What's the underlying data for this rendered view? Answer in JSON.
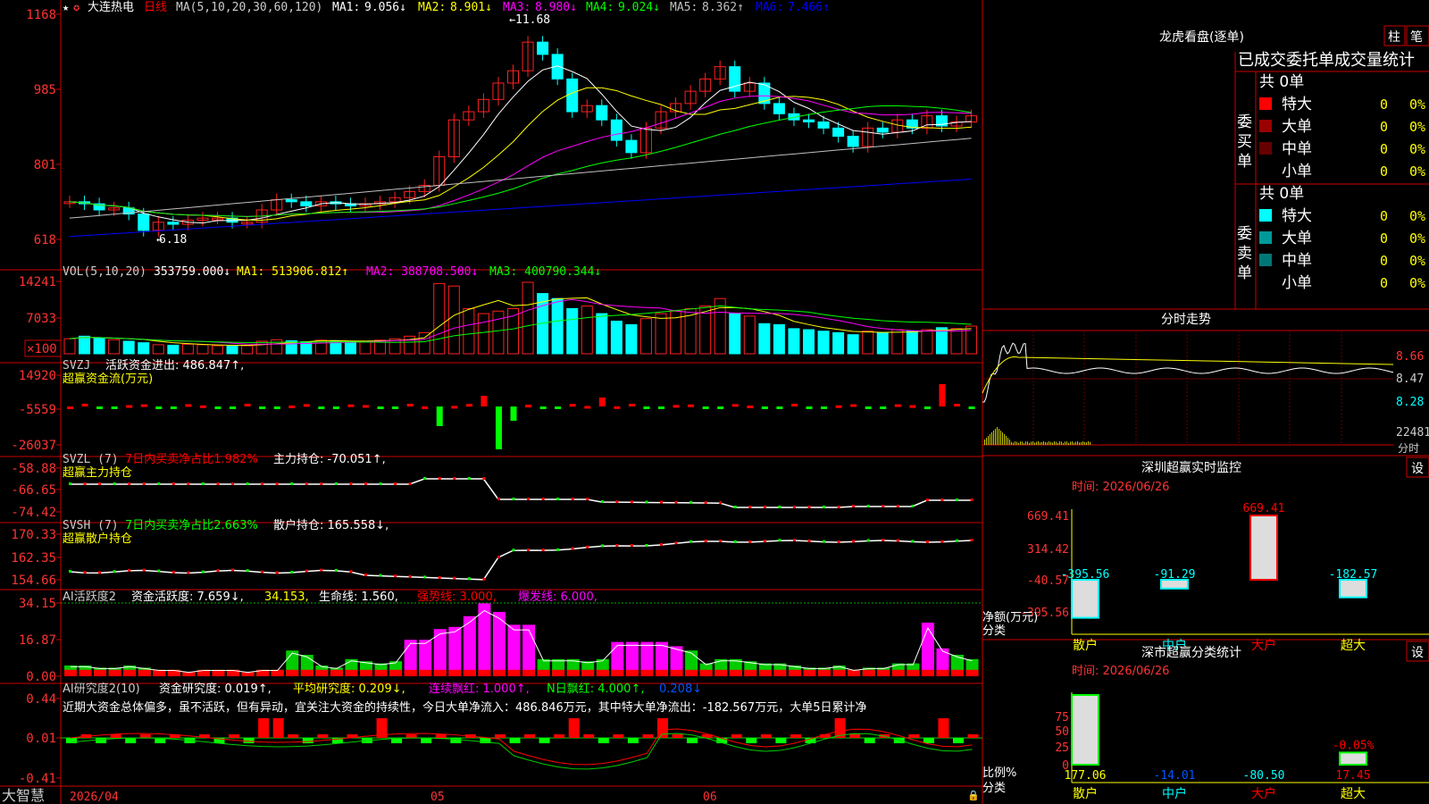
{
  "stock": {
    "name": "大连热电",
    "period": "日线",
    "ma_label": "MA(5,10,20,30,60,120)",
    "ma": [
      {
        "label": "MA1:",
        "value": "9.056↓",
        "color": "#ffffff"
      },
      {
        "label": "MA2:",
        "value": "8.901↓",
        "color": "#ffff00"
      },
      {
        "label": "MA3:",
        "value": "8.980↓",
        "color": "#ff00ff"
      },
      {
        "label": "MA4:",
        "value": "9.024↓",
        "color": "#00ff00"
      },
      {
        "label": "MA5:",
        "value": "8.362↑",
        "color": "#c0c0c0"
      },
      {
        "label": "MA6:",
        "value": "7.466↑",
        "color": "#0000ff"
      }
    ],
    "y_ticks": [
      "1168",
      "985",
      "801",
      "618"
    ],
    "high_label": "11.68",
    "low_label": "6.18"
  },
  "vol": {
    "title": "VOL(5,10,20)",
    "value": "353759.000↓",
    "ma1": "MA1: 513906.812↑",
    "ma2": "MA2: 388708.500↓",
    "ma3": "MA3: 400790.344↓",
    "y_ticks": [
      "14241",
      "7033",
      "×100"
    ]
  },
  "svzj": {
    "title": "SVZJ",
    "desc": "活跃资金进出: 486.847↑,",
    "sub": "超赢资金流(万元)",
    "y_ticks": [
      "14920",
      "-5559",
      "-26037"
    ]
  },
  "svzl": {
    "title": "SVZL (7)",
    "desc1": "7日内买卖净占比1.982%",
    "desc2": "主力持仓: -70.051↑,",
    "sub": "超赢主力持仓",
    "y_ticks": [
      "-58.88",
      "-66.65",
      "-74.42"
    ]
  },
  "svsh": {
    "title": "SVSH (7)",
    "desc1": "7日内买卖净占比2.663%",
    "desc2": "散户持仓: 165.558↓,",
    "sub": "超赢散户持仓",
    "y_ticks": [
      "170.33",
      "162.35",
      "154.66"
    ]
  },
  "ai1": {
    "title": "AI活跃度2",
    "a": "资金活跃度: 7.659↓,",
    "b": "34.153,",
    "c": "生命线: 1.560,",
    "d": "强势线: 3.000,",
    "e": "爆发线: 6.000,",
    "y_ticks": [
      "34.15",
      "16.87",
      "0.00"
    ]
  },
  "ai2": {
    "title": "AI研究度2(10)",
    "a": "资金研究度: 0.019↑,",
    "b": "平均研究度: 0.209↓,",
    "c": "连续飘红: 1.000↑,",
    "d": "N日飘红: 4.000↑,",
    "e": "0.208↓",
    "comment": "近期大资金总体偏多，虽不活跃，但有异动，宜关注大资金的持续性，今日大单净流入：486.846万元，其中特大单净流出：-182.567万元，大单5日累计净",
    "y_ticks": [
      "0.44",
      "0.01",
      "-0.41"
    ]
  },
  "xaxis": {
    "brand": "大智慧",
    "labels": [
      "2026/04",
      "05",
      "06"
    ]
  },
  "dragon": {
    "title": "龙虎看盘(逐单)",
    "btn1": "柱",
    "btn2": "笔",
    "subtitle": "已成交委托单成交量统计",
    "buy": {
      "side": "委买单",
      "total": "共 0单",
      "rows": [
        {
          "name": "特大",
          "n": "0",
          "p": "0%",
          "color": "#ff0000"
        },
        {
          "name": "大单",
          "n": "0",
          "p": "0%",
          "color": "#990000"
        },
        {
          "name": "中单",
          "n": "0",
          "p": "0%",
          "color": "#660000"
        },
        {
          "name": "小单",
          "n": "0",
          "p": "0%",
          "color": ""
        }
      ]
    },
    "sell": {
      "side": "委卖单",
      "total": "共 0单",
      "rows": [
        {
          "name": "特大",
          "n": "0",
          "p": "0%",
          "color": "#00ffff"
        },
        {
          "name": "大单",
          "n": "0",
          "p": "0%",
          "color": "#009999"
        },
        {
          "name": "中单",
          "n": "0",
          "p": "0%",
          "color": "#007777"
        },
        {
          "name": "小单",
          "n": "0",
          "p": "0%",
          "color": ""
        }
      ]
    }
  },
  "fenshi": {
    "title": "分时走势",
    "p1": "8.66",
    "p2": "8.47",
    "p3": "8.28",
    "vol": "22481",
    "unit": "分时"
  },
  "sz_monitor": {
    "title": "深圳超赢实时监控",
    "btn": "设",
    "time": "时间: 2026/06/26",
    "y_ticks": [
      "669.41",
      "314.42",
      "-40.57",
      "-395.56"
    ],
    "ylabel": "净额(万元)",
    "xlabel": "分类",
    "bars": [
      {
        "name": "散户",
        "value": -395.56,
        "label": "-395.56"
      },
      {
        "name": "中户",
        "value": -91.29,
        "label": "-91.29"
      },
      {
        "name": "大户",
        "value": 669.41,
        "label": "669.41"
      },
      {
        "name": "超大",
        "value": -182.57,
        "label": "-182.57"
      }
    ],
    "ylim": [
      -395.56,
      669.41
    ]
  },
  "sz_class": {
    "title": "深市超赢分类统计",
    "btn": "设",
    "time": "时间: 2026/06/26",
    "y_ticks": [
      "75",
      "50",
      "25",
      "0"
    ],
    "ylabel": "比例%",
    "xlabel": "分类",
    "bars": [
      {
        "name": "散户",
        "value": 100,
        "label": "177.06"
      },
      {
        "name": "中户",
        "value": 0,
        "label": "-14.01"
      },
      {
        "name": "大户",
        "value": 0,
        "label": "-80.50"
      },
      {
        "name": "超大",
        "value": 17.45,
        "label": "17.45",
        "top": "-0.05%"
      }
    ]
  },
  "colors": {
    "up": "#ff0000",
    "down": "#00ffff",
    "grid": "#cc0000",
    "green": "#00ff00",
    "magenta": "#ff00ff",
    "yellow": "#ffff00"
  },
  "icons": [
    "star-icon",
    "lock-icon"
  ]
}
